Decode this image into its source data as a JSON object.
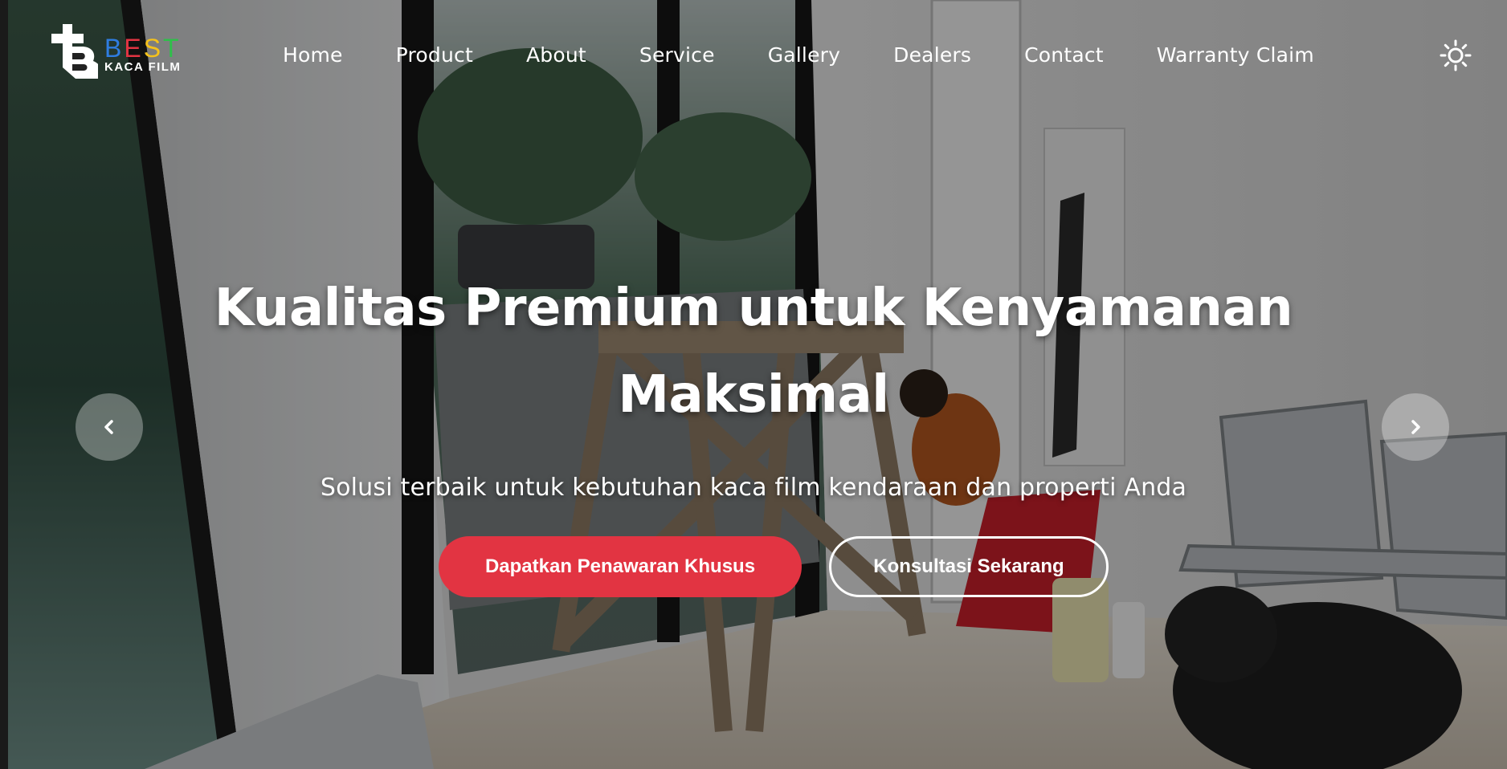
{
  "brand": {
    "logo_text": "BEST",
    "logo_letters": [
      {
        "char": "B",
        "color": "#2f7de1"
      },
      {
        "char": "E",
        "color": "#e23442"
      },
      {
        "char": "S",
        "color": "#f5c21b"
      },
      {
        "char": "T",
        "color": "#2fbf4a"
      }
    ],
    "logo_subtext": "KACA FILM"
  },
  "nav": {
    "items": [
      {
        "label": "Home",
        "name": "nav-home"
      },
      {
        "label": "Product",
        "name": "nav-product"
      },
      {
        "label": "About",
        "name": "nav-about"
      },
      {
        "label": "Service",
        "name": "nav-service"
      },
      {
        "label": "Gallery",
        "name": "nav-gallery"
      },
      {
        "label": "Dealers",
        "name": "nav-dealers"
      },
      {
        "label": "Contact",
        "name": "nav-contact"
      },
      {
        "label": "Warranty Claim",
        "name": "nav-warranty-claim"
      }
    ],
    "theme_toggle_icon": "sun-icon"
  },
  "hero": {
    "title": "Kualitas Premium untuk Kenyamanan Maksimal",
    "subtitle": "Solusi terbaik untuk kebutuhan kaca film kendaraan dan properti Anda",
    "primary_button": "Dapatkan Penawaran Khusus",
    "secondary_button": "Konsultasi Sekarang",
    "prev_icon": "chevron-left-icon",
    "next_icon": "chevron-right-icon"
  },
  "colors": {
    "accent_red": "#e23442",
    "text": "#ffffff",
    "overlay": "rgba(0,0,0,0.38)"
  }
}
